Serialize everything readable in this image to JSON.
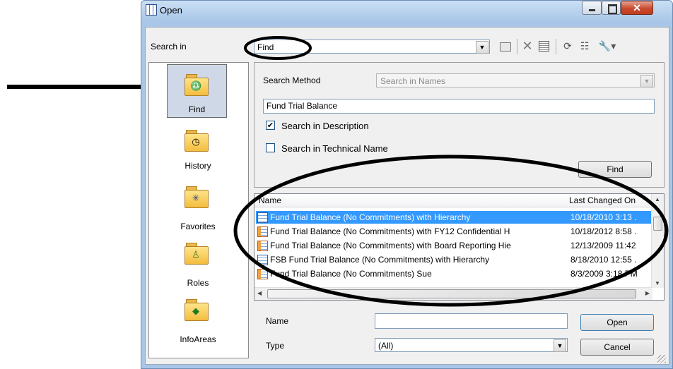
{
  "window": {
    "title": "Open"
  },
  "toolbar": {
    "search_in_label": "Search in",
    "search_in_value": "Find"
  },
  "sidebar": {
    "items": [
      {
        "label": "Find",
        "icon": "binoculars-icon"
      },
      {
        "label": "History",
        "icon": "clock-icon"
      },
      {
        "label": "Favorites",
        "icon": "star-icon"
      },
      {
        "label": "Roles",
        "icon": "person-icon"
      },
      {
        "label": "InfoAreas",
        "icon": "diamond-icon"
      }
    ]
  },
  "search": {
    "method_label": "Search Method",
    "method_value": "Search in Names",
    "query": "Fund Trial Balance",
    "desc_label": "Search in Description",
    "desc_checked": true,
    "tech_label": "Search in Technical Name",
    "tech_checked": false,
    "find_button": "Find"
  },
  "results": {
    "columns": [
      "Name",
      "Last Changed On"
    ],
    "rows": [
      {
        "name": "Fund Trial Balance (No Commitments) with Hierarchy",
        "date": "10/18/2010 3:13 .",
        "selected": true
      },
      {
        "name": "Fund Trial Balance (No Commitments) with FY12 Confidential H",
        "date": "10/18/2012 8:58 ."
      },
      {
        "name": "Fund Trial Balance (No Commitments) with Board Reporting Hie",
        "date": "12/13/2009 11:42"
      },
      {
        "name": "FSB Fund Trial Balance (No Commitments) with Hierarchy",
        "date": "8/18/2010 12:55 ."
      },
      {
        "name": "Fund Trial Balance (No Commitments) Sue",
        "date": "8/3/2009 3:18 PM"
      }
    ]
  },
  "footer": {
    "name_label": "Name",
    "name_value": "",
    "type_label": "Type",
    "type_value": "(All)",
    "open_button": "Open",
    "cancel_button": "Cancel"
  },
  "colors": {
    "selection": "#3399ff",
    "annotation": "#000000"
  }
}
